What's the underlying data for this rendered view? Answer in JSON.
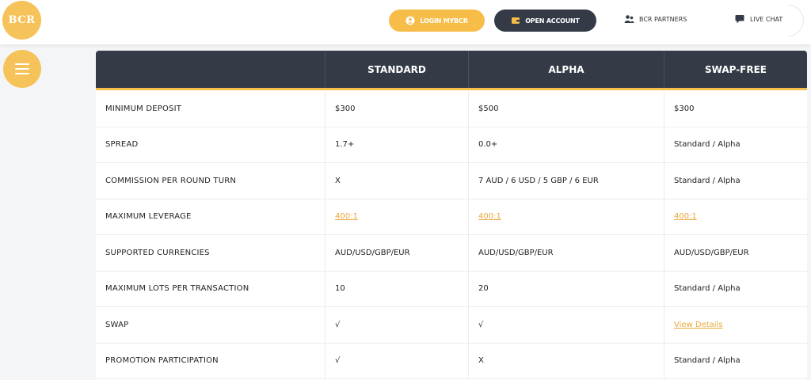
{
  "header": {
    "logo_text": "BCR",
    "login_label": "LOGIN MYBCR",
    "open_account_label": "OPEN ACCOUNT",
    "partners_label": "BCR PARTNERS",
    "live_chat_label": "LIVE CHAT"
  },
  "table": {
    "columns": [
      "",
      "STANDARD",
      "ALPHA",
      "SWAP-FREE"
    ],
    "rows": [
      {
        "label": "MINIMUM DEPOSIT",
        "cells": [
          {
            "text": "$300"
          },
          {
            "text": "$500"
          },
          {
            "text": "$300"
          }
        ]
      },
      {
        "label": "SPREAD",
        "cells": [
          {
            "text": "1.7+"
          },
          {
            "text": "0.0+"
          },
          {
            "text": "Standard / Alpha"
          }
        ]
      },
      {
        "label": "COMMISSION PER ROUND TURN",
        "cells": [
          {
            "text": "X"
          },
          {
            "text": "7 AUD / 6 USD / 5 GBP / 6 EUR"
          },
          {
            "text": "Standard / Alpha"
          }
        ]
      },
      {
        "label": "MAXIMUM LEVERAGE",
        "cells": [
          {
            "text": "400:1",
            "link": true
          },
          {
            "text": "400:1",
            "link": true
          },
          {
            "text": "400:1",
            "link": true
          }
        ]
      },
      {
        "label": "SUPPORTED CURRENCIES",
        "cells": [
          {
            "text": "AUD/USD/GBP/EUR"
          },
          {
            "text": "AUD/USD/GBP/EUR"
          },
          {
            "text": "AUD/USD/GBP/EUR"
          }
        ]
      },
      {
        "label": "MAXIMUM LOTS PER TRANSACTION",
        "cells": [
          {
            "text": "10"
          },
          {
            "text": "20"
          },
          {
            "text": "Standard / Alpha"
          }
        ]
      },
      {
        "label": "SWAP",
        "cells": [
          {
            "text": "√"
          },
          {
            "text": "√"
          },
          {
            "text": "View Details",
            "link": true
          }
        ]
      },
      {
        "label": "PROMOTION PARTICIPATION",
        "cells": [
          {
            "text": "√"
          },
          {
            "text": "X"
          },
          {
            "text": "Standard / Alpha"
          }
        ]
      }
    ]
  },
  "colors": {
    "accent": "#f6bd48",
    "header_dark": "#343b47",
    "link": "#e9a93a"
  },
  "icons": {
    "login": "user-circle-icon",
    "open_account": "wallet-icon",
    "partners": "partners-icon",
    "live_chat": "chat-bubble-icon",
    "menu": "hamburger-menu-icon"
  }
}
